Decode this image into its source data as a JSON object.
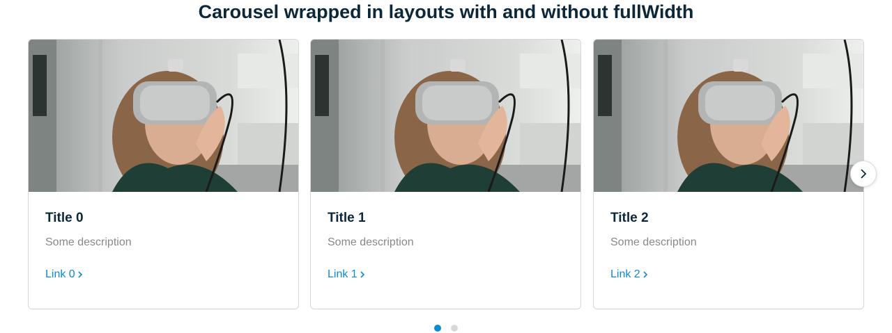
{
  "heading": "Carousel wrapped in layouts with and without fullWidth",
  "cards": [
    {
      "title": "Title 0",
      "description": "Some description",
      "link": "Link 0",
      "image": "woman-vr-headset-photo"
    },
    {
      "title": "Title 1",
      "description": "Some description",
      "link": "Link 1",
      "image": "woman-vr-headset-photo"
    },
    {
      "title": "Title 2",
      "description": "Some description",
      "link": "Link 2",
      "image": "woman-vr-headset-photo"
    }
  ],
  "navigation": {
    "next_icon": "chevron-right-icon",
    "link_icon": "chevron-right-icon",
    "page_count": 2,
    "active_page": 1
  },
  "colors": {
    "heading": "#0b2739",
    "link": "#0a8bd0",
    "description": "#86888c",
    "active_dot": "#0a8bd0",
    "inactive_dot": "#d8d8d8"
  }
}
